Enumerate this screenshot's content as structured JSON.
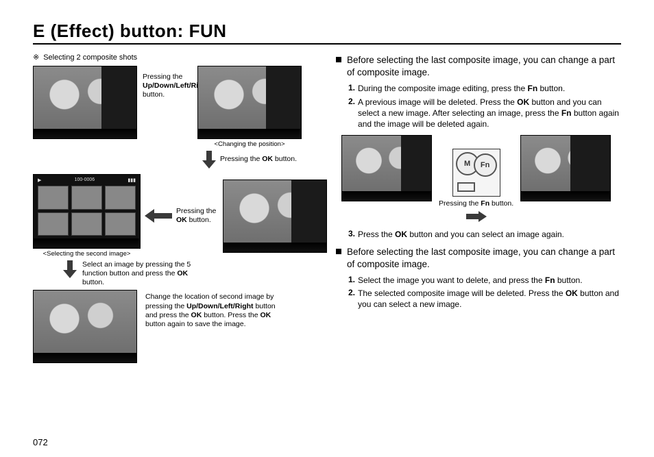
{
  "page_number": "072",
  "title": "E (Effect) button: FUN",
  "left": {
    "subhead": "Selecting 2 composite shots",
    "press_udlr_1": "Pressing the ",
    "press_udlr_2": "Up/Down/Left/Right",
    "press_udlr_3": " button.",
    "changing_pos_caption": "<Changing the position>",
    "press_ok_1": "Pressing the ",
    "press_ok_2": "OK",
    "press_ok_3": " button.",
    "select_second_caption": "<Selecting the second image>",
    "grid_counter": "100-0006",
    "select5_1": "Select an image by pressing the 5 function button and press the ",
    "select5_2": "OK",
    "select5_3": " button.",
    "change_loc_1": "Change the location of second image by pressing the ",
    "change_loc_2": "Up/Down/Left/Right",
    "change_loc_3": " button and press the ",
    "change_loc_4": "OK",
    "change_loc_5": " button. Press the ",
    "change_loc_6": "OK",
    "change_loc_7": " button again to save the image."
  },
  "right": {
    "hd1": "Before selecting the last composite image, you can change a part of composite image.",
    "s1_1a": "During the composite image editing, press the ",
    "s1_1b": "Fn",
    "s1_1c": " button.",
    "s1_2a": "A previous image will be deleted. Press the ",
    "s1_2b": "OK",
    "s1_2c": " button and you can select a new image. After selecting an image, press the ",
    "s1_2d": "Fn",
    "s1_2e": " button again and the image will be deleted again.",
    "icon_M": "M",
    "icon_Fn": "Fn",
    "press_fn_1": "Pressing the ",
    "press_fn_2": "Fn",
    "press_fn_3": " button.",
    "s1_3a": "Press the ",
    "s1_3b": "OK",
    "s1_3c": " button and you can select an image again.",
    "hd2": "Before selecting the last composite image, you can change a part of composite image.",
    "s2_1a": "Select the image you want to delete, and press the ",
    "s2_1b": "Fn",
    "s2_1c": " button.",
    "s2_2a": "The selected composite image will be deleted. Press the ",
    "s2_2b": "OK",
    "s2_2c": " button and you can select a new image."
  }
}
